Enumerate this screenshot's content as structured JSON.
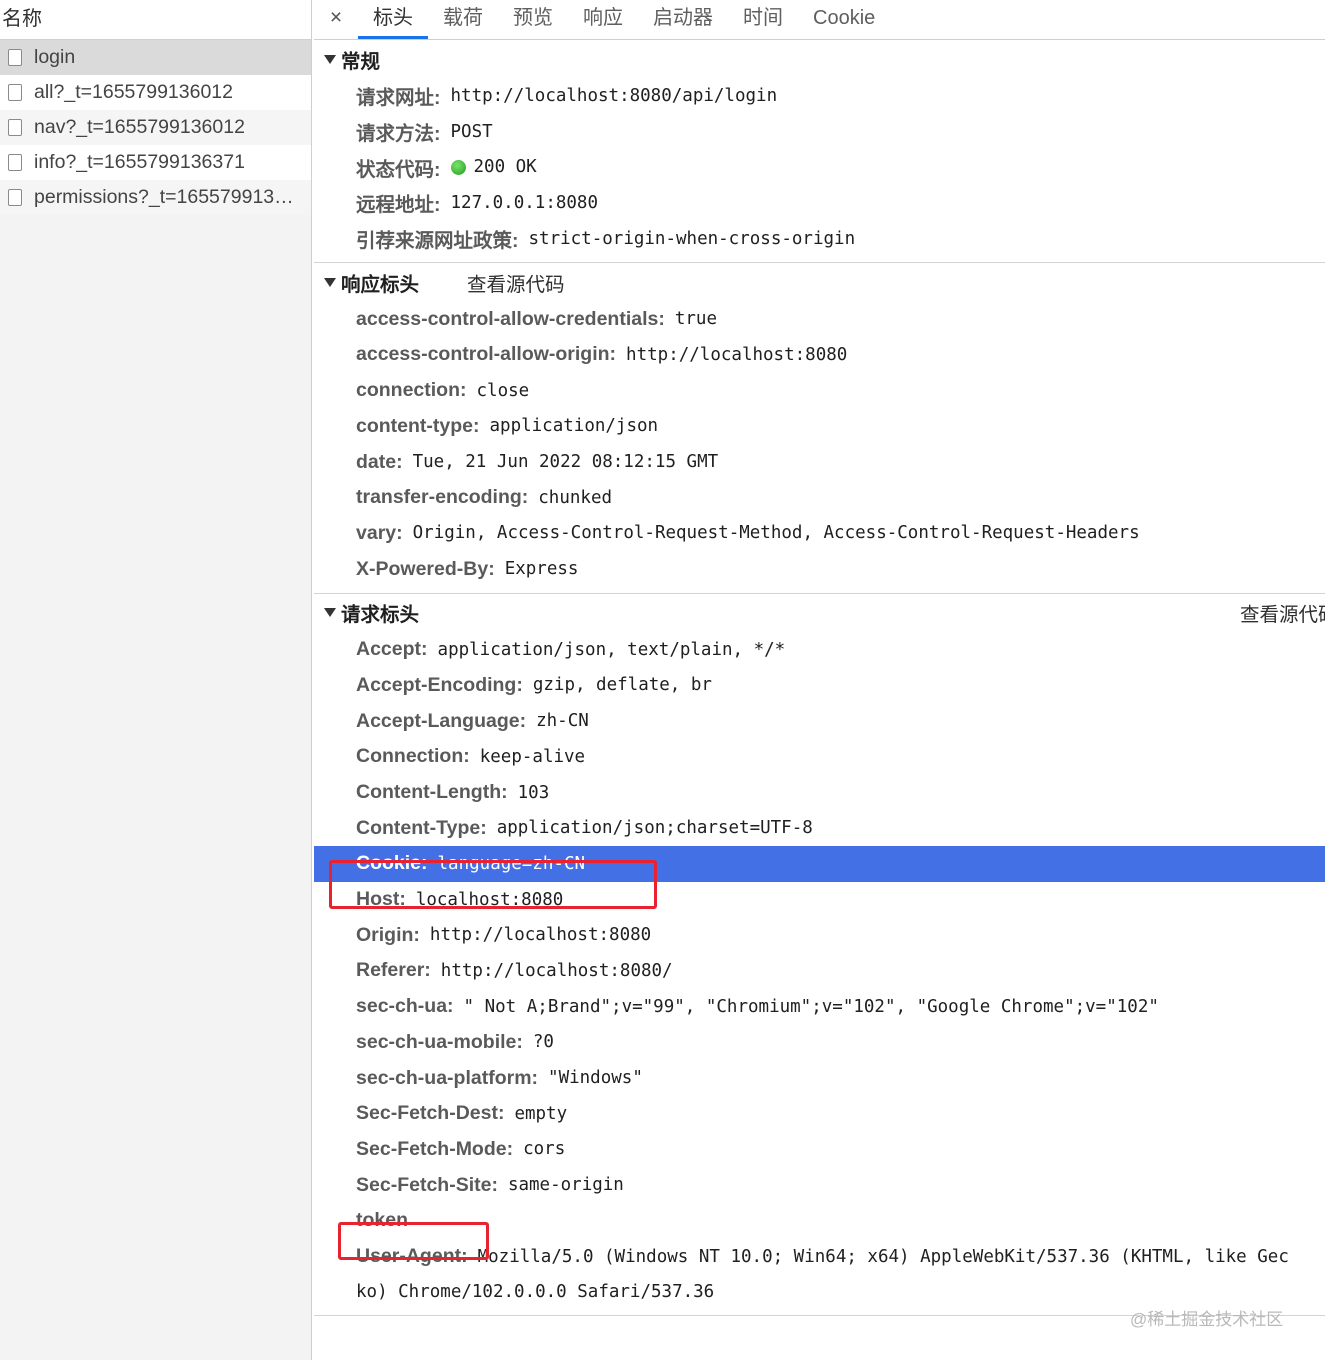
{
  "left": {
    "header": "名称",
    "items": [
      {
        "name": "login"
      },
      {
        "name": "all?_t=1655799136012"
      },
      {
        "name": "nav?_t=1655799136012"
      },
      {
        "name": "info?_t=1655799136371"
      },
      {
        "name": "permissions?_t=1655799136..."
      }
    ]
  },
  "tabs": {
    "close": "×",
    "items": [
      "标头",
      "载荷",
      "预览",
      "响应",
      "启动器",
      "时间",
      "Cookie"
    ],
    "active": "标头"
  },
  "general": {
    "title": "常规",
    "rows": [
      {
        "k": "请求网址:",
        "v": "http://localhost:8080/api/login"
      },
      {
        "k": "请求方法:",
        "v": "POST"
      },
      {
        "k": "状态代码:",
        "v": "200 OK"
      },
      {
        "k": "远程地址:",
        "v": "127.0.0.1:8080"
      },
      {
        "k": "引荐来源网址政策:",
        "v": "strict-origin-when-cross-origin"
      }
    ]
  },
  "response_headers": {
    "title": "响应标头",
    "view_source": "查看源代码",
    "rows": [
      {
        "k": "access-control-allow-credentials:",
        "v": "true"
      },
      {
        "k": "access-control-allow-origin:",
        "v": "http://localhost:8080"
      },
      {
        "k": "connection:",
        "v": "close"
      },
      {
        "k": "content-type:",
        "v": "application/json"
      },
      {
        "k": "date:",
        "v": "Tue, 21 Jun 2022 08:12:15 GMT"
      },
      {
        "k": "transfer-encoding:",
        "v": "chunked"
      },
      {
        "k": "vary:",
        "v": "Origin, Access-Control-Request-Method, Access-Control-Request-Headers"
      },
      {
        "k": "X-Powered-By:",
        "v": "Express"
      }
    ]
  },
  "request_headers": {
    "title": "请求标头",
    "view_source": "查看源代码",
    "rows": [
      {
        "k": "Accept:",
        "v": "application/json, text/plain, */*"
      },
      {
        "k": "Accept-Encoding:",
        "v": "gzip, deflate, br"
      },
      {
        "k": "Accept-Language:",
        "v": "zh-CN"
      },
      {
        "k": "Connection:",
        "v": "keep-alive"
      },
      {
        "k": "Content-Length:",
        "v": "103"
      },
      {
        "k": "Content-Type:",
        "v": "application/json;charset=UTF-8"
      },
      {
        "k": "Cookie:",
        "v": "language=zh-CN"
      },
      {
        "k": "Host:",
        "v": "localhost:8080"
      },
      {
        "k": "Origin:",
        "v": "http://localhost:8080"
      },
      {
        "k": "Referer:",
        "v": "http://localhost:8080/"
      },
      {
        "k": "sec-ch-ua:",
        "v": "\" Not A;Brand\";v=\"99\", \"Chromium\";v=\"102\", \"Google Chrome\";v=\"102\""
      },
      {
        "k": "sec-ch-ua-mobile:",
        "v": "?0"
      },
      {
        "k": "sec-ch-ua-platform:",
        "v": "\"Windows\""
      },
      {
        "k": "Sec-Fetch-Dest:",
        "v": "empty"
      },
      {
        "k": "Sec-Fetch-Mode:",
        "v": "cors"
      },
      {
        "k": "Sec-Fetch-Site:",
        "v": "same-origin"
      },
      {
        "k": "token",
        "v": ""
      }
    ],
    "user_agent": {
      "k": "User-Agent:",
      "v1": "Mozilla/5.0 (Windows NT 10.0; Win64; x64) AppleWebKit/537.36 (KHTML, like Gec",
      "v2": "ko) Chrome/102.0.0.0 Safari/537.36"
    }
  },
  "colors": {
    "highlight": "#4470e6",
    "annotation": "#e8232f",
    "tab_indicator": "#1a73e8",
    "status_ok": "#1e9d1e"
  },
  "watermark": "@稀土掘金技术社区"
}
